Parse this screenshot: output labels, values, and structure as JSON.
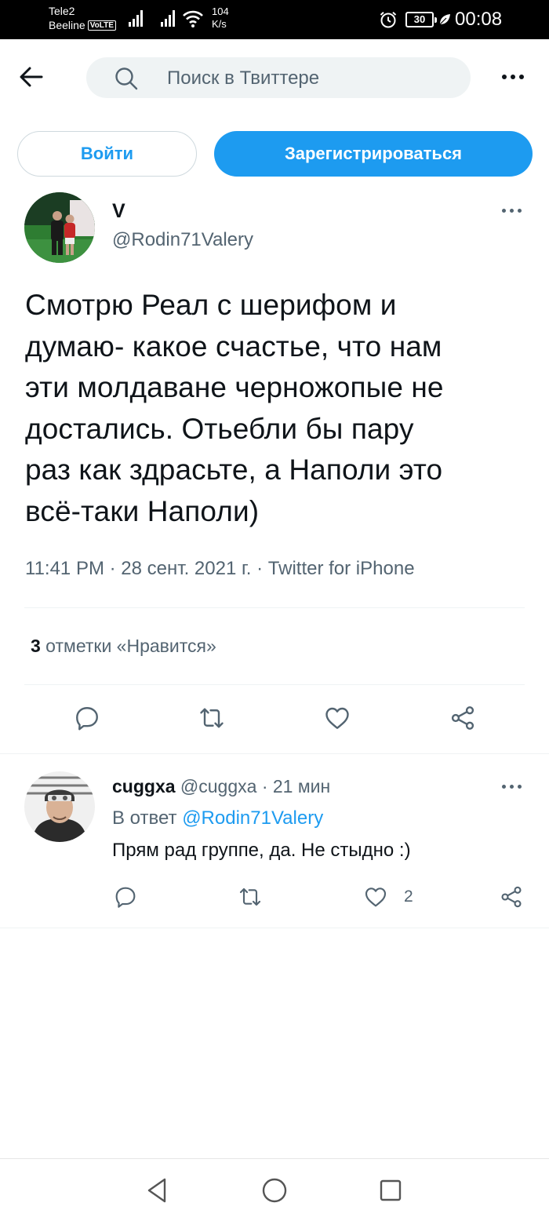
{
  "status_bar": {
    "carrier1": "Tele2",
    "carrier2": "Beeline",
    "volte": "VoLTE",
    "speed_value": "104",
    "speed_unit": "K/s",
    "battery": "30",
    "time": "00:08"
  },
  "header": {
    "search_placeholder": "Поиск в Твиттере"
  },
  "auth": {
    "login_label": "Войти",
    "signup_label": "Зарегистрироваться"
  },
  "tweet": {
    "author_name": "V",
    "author_handle": "@Rodin71Valery",
    "text_lines": [
      "Смотрю Реал с шерифом и",
      "думаю- какое счастье, что нам",
      "эти молдаване черножопые не",
      "достались. Отьебли бы пару",
      "раз как здрасьте, а Наполи это",
      "всё-таки Наполи)"
    ],
    "meta": "11:41 PM · 28 сент. 2021 г. · Twitter for iPhone",
    "likes_count": "3",
    "likes_label": " отметки «Нравится»"
  },
  "reply": {
    "author_name": "cuggxa",
    "author_handle": "@cuggxa",
    "time": " · 21 мин",
    "reply_to_prefix": "В ответ ",
    "reply_to_handle": "@Rodin71Valery",
    "text": "Прям рад группе, да. Не стыдно :)",
    "like_count": "2"
  },
  "colors": {
    "accent": "#1d9bf0",
    "text_primary": "#0f1419",
    "text_secondary": "#536471",
    "divider": "#eff3f4",
    "search_bg": "#eff3f4"
  }
}
